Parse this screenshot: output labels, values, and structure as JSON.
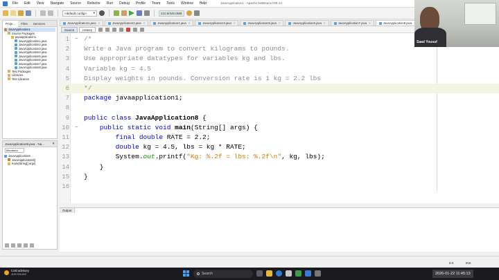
{
  "window": {
    "title": "JavaApplication1 - Apache NetBeans IDE 24",
    "menus": [
      "File",
      "Edit",
      "View",
      "Navigate",
      "Source",
      "Refactor",
      "Run",
      "Debug",
      "Profile",
      "Team",
      "Tools",
      "Window",
      "Help"
    ]
  },
  "toolbar": {
    "config": "<default config>",
    "memory": "210.6/346.0MB"
  },
  "projects_panel": {
    "tabs": [
      "Proje...",
      "Files",
      "Services"
    ],
    "tree": [
      {
        "label": "JavaApplication1",
        "icon": "coffee-icon",
        "indent": 0,
        "selected": true
      },
      {
        "label": "Source Packages",
        "icon": "folder-icon",
        "indent": 1
      },
      {
        "label": "javaapplication1",
        "icon": "package-icon",
        "indent": 2
      },
      {
        "label": "JavaApplication1.java",
        "icon": "java-file-icon",
        "indent": 3
      },
      {
        "label": "JavaApplication2.java",
        "icon": "java-file-icon",
        "indent": 3
      },
      {
        "label": "JavaApplication3.java",
        "icon": "java-file-icon",
        "indent": 3
      },
      {
        "label": "JavaApplication4.java",
        "icon": "java-file-icon",
        "indent": 3
      },
      {
        "label": "JavaApplication5.java",
        "icon": "java-file-icon",
        "indent": 3
      },
      {
        "label": "JavaApplication6.java",
        "icon": "java-file-icon",
        "indent": 3
      },
      {
        "label": "JavaApplication7.java",
        "icon": "java-file-icon",
        "indent": 3
      },
      {
        "label": "JavaApplication8.java",
        "icon": "java-file-icon",
        "indent": 3
      },
      {
        "label": "Test Packages",
        "icon": "folder-icon",
        "indent": 1
      },
      {
        "label": "Libraries",
        "icon": "folder-icon",
        "indent": 1
      },
      {
        "label": "Test Libraries",
        "icon": "folder-icon",
        "indent": 1
      }
    ]
  },
  "navigator": {
    "title": "JavaApplication8.java - Na...",
    "filter": "Members",
    "items": [
      {
        "label": "JavaApplication8",
        "icon": "class-icon",
        "indent": 0
      },
      {
        "label": "JavaApplication8()",
        "icon": "constructor-icon",
        "indent": 1
      },
      {
        "label": "main(String[] args)",
        "icon": "method-icon",
        "indent": 1
      }
    ]
  },
  "editor": {
    "tabs": [
      {
        "label": "JavaApplication1.java",
        "active": false
      },
      {
        "label": "JavaApplication2.java",
        "active": false
      },
      {
        "label": "JavaApplication4.java",
        "active": false
      },
      {
        "label": "JavaApplication3.java",
        "active": false
      },
      {
        "label": "JavaApplication5.java",
        "active": false
      },
      {
        "label": "JavaApplication6.java",
        "active": false
      },
      {
        "label": "JavaApplication7.java",
        "active": false
      },
      {
        "label": "JavaApplication8.java",
        "active": true
      }
    ],
    "source_tabs": [
      "Source",
      "History"
    ],
    "lines": [
      {
        "n": "1",
        "tokens": [
          {
            "t": "/*",
            "c": "com"
          }
        ],
        "fold": "−"
      },
      {
        "n": "2",
        "tokens": [
          {
            "t": "Write a Java program to convert kilograms to pounds.",
            "c": "com"
          }
        ]
      },
      {
        "n": "3",
        "tokens": [
          {
            "t": "Use appropriate datatypes for variables kg and lbs.",
            "c": "com"
          }
        ]
      },
      {
        "n": "4",
        "tokens": [
          {
            "t": "Variable kg = 4.5",
            "c": "com"
          }
        ]
      },
      {
        "n": "5",
        "tokens": [
          {
            "t": "Display weights in pounds. Conversion rate is 1 kg = 2.2 lbs",
            "c": "com"
          }
        ]
      },
      {
        "n": "6",
        "tokens": [
          {
            "t": "*/",
            "c": "com"
          }
        ],
        "highlight": true
      },
      {
        "n": "7",
        "tokens": [
          {
            "t": "package",
            "c": "kw"
          },
          {
            "t": " javaapplication1;",
            "c": ""
          }
        ]
      },
      {
        "n": "8",
        "tokens": []
      },
      {
        "n": "9",
        "tokens": [
          {
            "t": "public class",
            "c": "kw"
          },
          {
            "t": " ",
            "c": ""
          },
          {
            "t": "JavaApplication8",
            "c": "cls"
          },
          {
            "t": " {",
            "c": ""
          }
        ]
      },
      {
        "n": "10",
        "tokens": [
          {
            "t": "    public static void",
            "c": "kw"
          },
          {
            "t": " ",
            "c": ""
          },
          {
            "t": "main",
            "c": "cls"
          },
          {
            "t": "(String[] args) {",
            "c": ""
          }
        ],
        "fold": "−"
      },
      {
        "n": "11",
        "tokens": [
          {
            "t": "        final double",
            "c": "kw"
          },
          {
            "t": " RATE = 2.2;",
            "c": ""
          }
        ]
      },
      {
        "n": "12",
        "tokens": [
          {
            "t": "        double",
            "c": "kw"
          },
          {
            "t": " kg = 4.5, lbs = kg * RATE;",
            "c": ""
          }
        ]
      },
      {
        "n": "13",
        "tokens": [
          {
            "t": "        System.",
            "c": ""
          },
          {
            "t": "out",
            "c": "fld"
          },
          {
            "t": ".printf(",
            "c": ""
          },
          {
            "t": "\"Kg: %.2f = lbs: %.2f\\n\"",
            "c": "str"
          },
          {
            "t": ", kg, lbs);",
            "c": ""
          }
        ]
      },
      {
        "n": "14",
        "tokens": [
          {
            "t": "    }",
            "c": ""
          }
        ]
      },
      {
        "n": "15",
        "tokens": [
          {
            "t": "}",
            "c": ""
          }
        ]
      },
      {
        "n": "16",
        "tokens": []
      }
    ]
  },
  "output": {
    "tab": "Output"
  },
  "status": {
    "position": "6:3",
    "mode": "INS"
  },
  "webcam": {
    "name": "Saad Yousuf"
  },
  "taskbar": {
    "weather_title": "Cold advisory",
    "weather_sub": "Just issued",
    "search": "Search",
    "datetime": "2026-01-22  11:45:13"
  },
  "colors": {
    "keyword": "#0000e6",
    "comment": "#8c8c8c",
    "string": "#ce7b00",
    "field": "#009900",
    "taskbar": "#1b1b1f"
  }
}
